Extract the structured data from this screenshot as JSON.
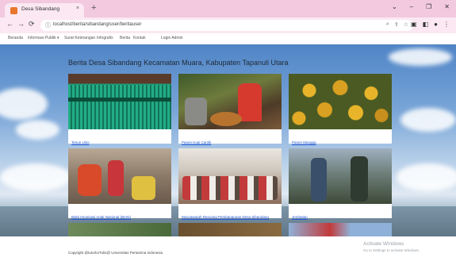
{
  "browser": {
    "tab_title": "Desa Sibandang",
    "tab_close": "×",
    "new_tab": "+",
    "win_controls": [
      "⌄",
      "–",
      "❐",
      "✕"
    ],
    "url": "localhost/berita/sibandang/user/beritauser",
    "nav": {
      "back": "←",
      "forward": "→",
      "reload": "⟳"
    },
    "lock": "ⓘ",
    "omni_icons": [
      "⌕",
      "⇪",
      "☆"
    ],
    "ext_icons": [
      "▣",
      "◧",
      "●",
      "⋮"
    ]
  },
  "site_nav": [
    "Beranda",
    "Informasi Publik ▾",
    "Surat Keterangan",
    "Infografis",
    "Berita",
    "Kontak",
    "Login Admin"
  ],
  "page": {
    "title": "Berita Desa Sibandang Kecamatan Muara, Kabupaten Tapanuli Utara"
  },
  "cards": [
    {
      "caption": "Tenun Ulos"
    },
    {
      "caption": "Panen Kopi Cantik"
    },
    {
      "caption": "Panen Mangga"
    },
    {
      "caption": "Bakti Imunisasi Anak Nasional (BIAN)"
    },
    {
      "caption": "Musyawarah Rencana Pembangunan Desa Sibandang"
    },
    {
      "caption": "Jembatan"
    }
  ],
  "footer": {
    "copyright": "Copyright @tutorlorTulis@ Universitas Pertamina Indonesia",
    "activate_line1": "Activate Windows",
    "activate_line2": "Go to Settings to activate Windows."
  }
}
